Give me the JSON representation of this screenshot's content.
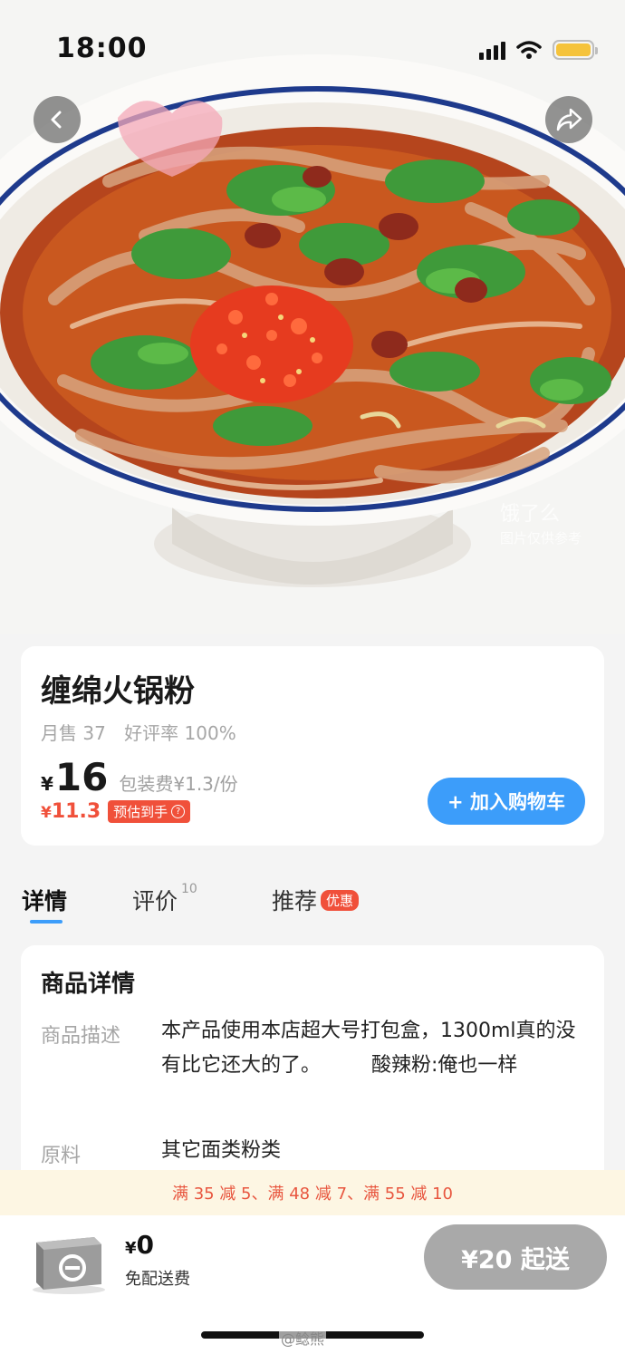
{
  "status_bar": {
    "time": "18:00"
  },
  "hero": {
    "watermark_logo": "饿了么",
    "watermark_sub": "图片仅供参考"
  },
  "product": {
    "name": "缠绵火锅粉",
    "monthly_sales": "月售 37",
    "rating": "好评率 100%",
    "currency": "¥",
    "price": "16",
    "packaging_fee": "包装费¥1.3/份",
    "est_currency": "¥",
    "est_price": "11.3",
    "est_label": "预估到手",
    "add_to_cart": "+ 加入购物车"
  },
  "tabs": [
    {
      "label": "详情",
      "active": true
    },
    {
      "label": "评价",
      "count": "10"
    },
    {
      "label": "推荐",
      "badge": "优惠"
    }
  ],
  "details": {
    "title": "商品详情",
    "rows": [
      {
        "label": "商品描述",
        "value": "本产品使用本店超大号打包盒，1300ml真的没有比它还大的了。        酸辣粉:俺也一样"
      },
      {
        "label": "原料",
        "value": "其它面类粉类"
      }
    ]
  },
  "promo": {
    "text": "满 35 减 5、满 48 减 7、满 55 减 10"
  },
  "bottom_bar": {
    "currency": "¥",
    "cart_total": "0",
    "delivery_note": "免配送费",
    "min_order": "¥20 起送"
  },
  "watermark": "@鲶熊",
  "colors": {
    "accent_blue": "#3c9dfa",
    "promo_red": "#f0503a",
    "disabled_gray": "#a9a9a9"
  },
  "icons": [
    "back-arrow-icon",
    "share-icon",
    "cart-box-icon",
    "signal-icon",
    "wifi-icon",
    "battery-icon"
  ]
}
